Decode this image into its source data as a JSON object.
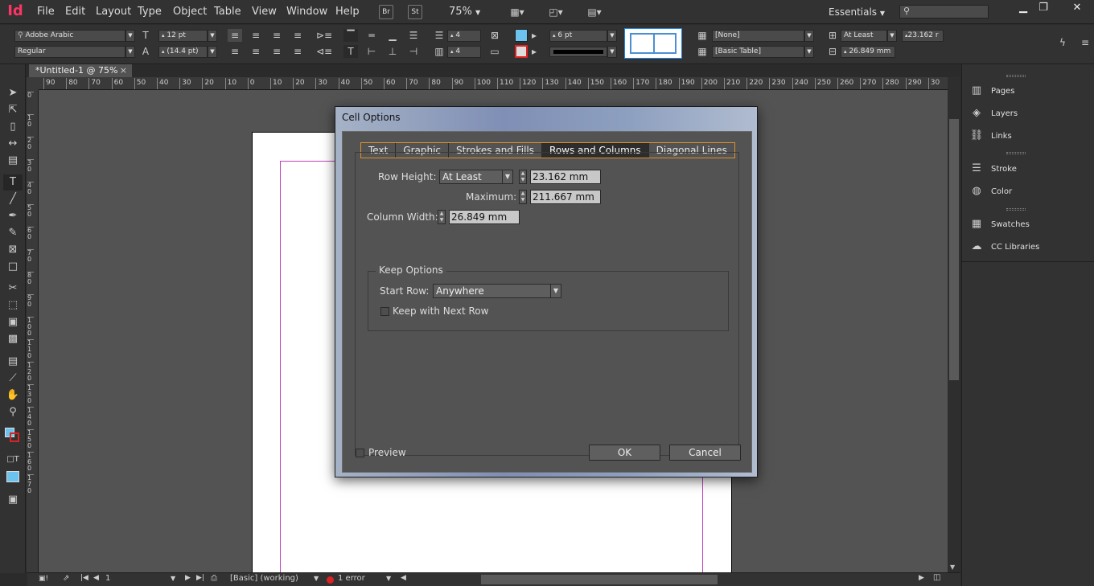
{
  "app": {
    "logo": "Id",
    "workspace": "Essentials"
  },
  "menubar": {
    "items": [
      "File",
      "Edit",
      "Layout",
      "Type",
      "Object",
      "Table",
      "View",
      "Window",
      "Help"
    ],
    "bridge": "Br",
    "stock": "St",
    "zoom": "75%",
    "search_placeholder": ""
  },
  "control": {
    "font_family": "Adobe Arabic",
    "font_style": "Regular",
    "font_size": "12 pt",
    "leading": "(14.4 pt)",
    "rows": "4",
    "cols": "4",
    "stroke_weight": "6 pt",
    "cell_style": "[None]",
    "table_style": "[Basic Table]",
    "row_height_mode": "At Least",
    "row_height": "23.162 r",
    "col_width": "26.849 mm"
  },
  "document": {
    "tab_title": "*Untitled-1 @ 75%",
    "close": "×"
  },
  "ruler": {
    "h_ticks": [
      "90",
      "80",
      "70",
      "60",
      "50",
      "40",
      "30",
      "20",
      "10",
      "0",
      "10",
      "20",
      "30",
      "40",
      "50",
      "60",
      "70",
      "80",
      "90",
      "100",
      "110",
      "120",
      "130",
      "140",
      "150",
      "160",
      "170",
      "180",
      "190",
      "200",
      "210",
      "220",
      "230",
      "240",
      "250",
      "260",
      "270",
      "280",
      "290",
      "30"
    ],
    "v_ticks": [
      "0",
      "1 0",
      "2 0",
      "3 0",
      "4 0",
      "5 0",
      "6 0",
      "7 0",
      "8 0",
      "9 0",
      "1 0 0",
      "1 1 0",
      "1 2 0",
      "1 3 0",
      "1 4 0",
      "1 5 0",
      "1 6 0",
      "1 7 0"
    ]
  },
  "status": {
    "page": "1",
    "style": "[Basic] (working)",
    "errors": "1 error"
  },
  "panels": [
    {
      "icon": "pages-icon",
      "label": "Pages"
    },
    {
      "icon": "layers-icon",
      "label": "Layers"
    },
    {
      "icon": "links-icon",
      "label": "Links"
    },
    {
      "icon": "stroke-icon",
      "label": "Stroke"
    },
    {
      "icon": "color-icon",
      "label": "Color"
    },
    {
      "icon": "swatches-icon",
      "label": "Swatches"
    },
    {
      "icon": "cc-libraries-icon",
      "label": "CC Libraries"
    }
  ],
  "dialog": {
    "title": "Cell Options",
    "tabs": [
      "Text",
      "Graphic",
      "Strokes and Fills",
      "Rows and Columns",
      "Diagonal Lines"
    ],
    "active_tab": "Rows and Columns",
    "row_height_label": "Row Height:",
    "row_height_mode": "At Least",
    "row_height_value": "23.162 mm",
    "maximum_label": "Maximum:",
    "maximum_value": "211.667 mm",
    "column_width_label": "Column Width:",
    "column_width_value": "26.849 mm",
    "keep_options_label": "Keep Options",
    "start_row_label": "Start Row:",
    "start_row_value": "Anywhere",
    "keep_with_next_label": "Keep with Next Row",
    "keep_with_next_checked": false,
    "preview_label": "Preview",
    "preview_checked": false,
    "ok_label": "OK",
    "cancel_label": "Cancel"
  }
}
